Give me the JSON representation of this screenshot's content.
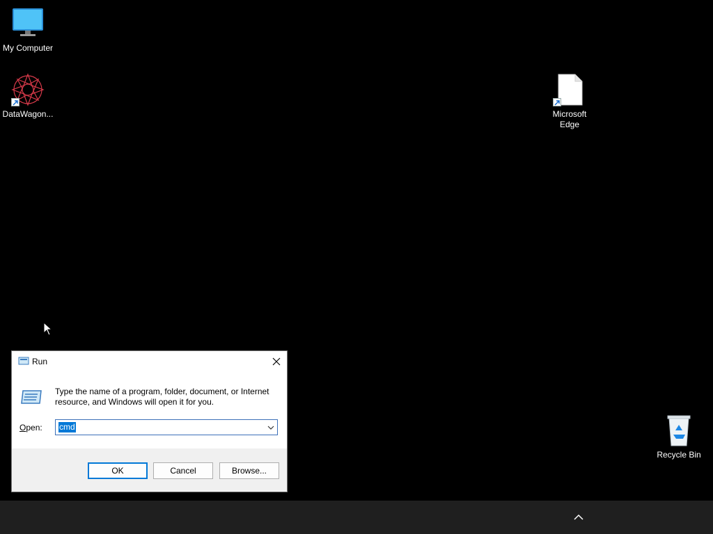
{
  "desktop": {
    "icons": [
      {
        "label": "My Computer",
        "icon": "monitor-icon"
      },
      {
        "label": "DataWagon...",
        "icon": "datawagon-app-icon"
      },
      {
        "label": "Microsoft Edge",
        "icon": "document-icon"
      },
      {
        "label": "Recycle Bin",
        "icon": "recycle-bin-icon"
      }
    ]
  },
  "run_dialog": {
    "title": "Run",
    "description": "Type the name of a program, folder, document, or Internet resource, and Windows will open it for you.",
    "open_label": "Open:",
    "input_value": "cmd",
    "buttons": {
      "ok": "OK",
      "cancel": "Cancel",
      "browse": "Browse..."
    }
  },
  "taskbar": {
    "tray_icon": "chevron-up-icon"
  },
  "colors": {
    "desktop_bg": "#000000",
    "taskbar_bg": "#1f1f1f",
    "accent": "#0078d7"
  }
}
